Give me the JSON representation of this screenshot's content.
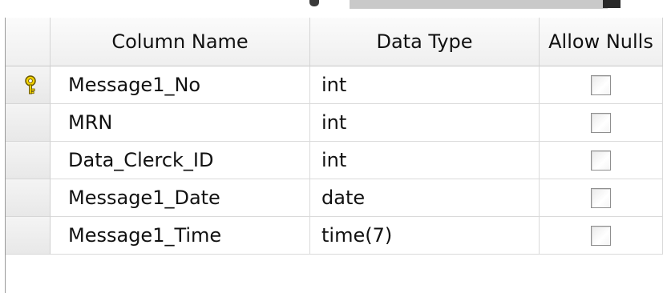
{
  "table_designer": {
    "columns": {
      "name": "Column Name",
      "type": "Data Type",
      "nulls": "Allow Nulls"
    },
    "rows": [
      {
        "name": "Message1_No",
        "type": "int",
        "allow_nulls": false,
        "primary_key": true,
        "row_icon": "key-icon"
      },
      {
        "name": "MRN",
        "type": "int",
        "allow_nulls": false,
        "primary_key": false
      },
      {
        "name": "Data_Clerck_ID",
        "type": "int",
        "allow_nulls": false,
        "primary_key": false
      },
      {
        "name": "Message1_Date",
        "type": "date",
        "allow_nulls": false,
        "primary_key": false
      },
      {
        "name": "Message1_Time",
        "type": "time(7)",
        "allow_nulls": false,
        "primary_key": false
      }
    ]
  },
  "colors": {
    "header_bg": "#f3f3f3",
    "grid_line": "#dadada",
    "key_icon": "#d6b100"
  }
}
